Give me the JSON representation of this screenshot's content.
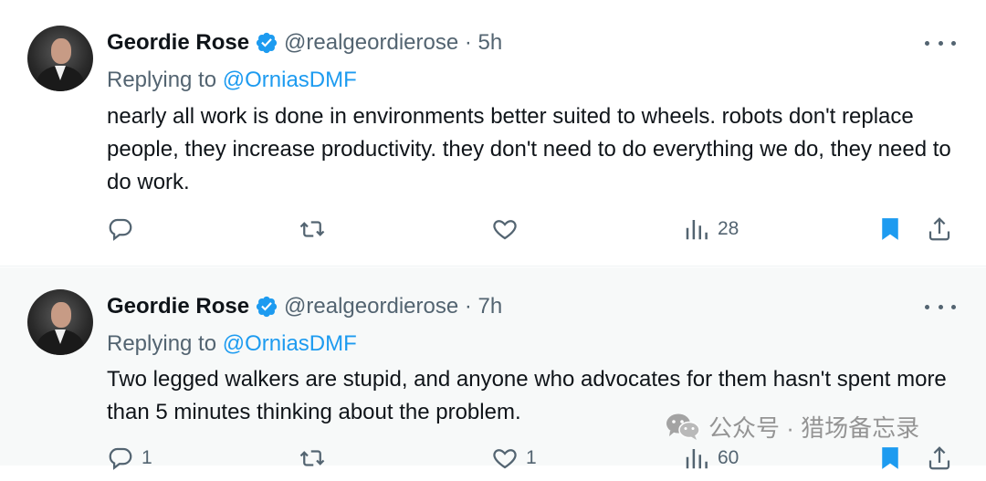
{
  "tweets": [
    {
      "name": "Geordie Rose",
      "handle": "@realgeordierose · 5h",
      "replying_prefix": "Replying to",
      "replying_to": "@OrniasDMF",
      "text": "nearly all work is done in environments better suited to wheels. robots don't replace people, they increase productivity. they don't need to do everything we do, they need to do work.",
      "views": "28",
      "bookmarked": true
    },
    {
      "name": "Geordie Rose",
      "handle": "@realgeordierose · 7h",
      "replying_prefix": "Replying to",
      "replying_to": "@OrniasDMF",
      "text": "Two legged walkers are stupid, and anyone who advocates for them hasn't spent more than 5 minutes thinking about the problem.",
      "replies": "1",
      "likes": "1",
      "views": "60",
      "bookmarked": true
    }
  ],
  "watermark": {
    "text": "公众号 · 猎场备忘录"
  },
  "colors": {
    "accent": "#1d9bf0",
    "muted": "#536471",
    "text": "#0f1419"
  },
  "icons": [
    "verified-badge-icon",
    "more-icon",
    "reply-icon",
    "retweet-icon",
    "like-icon",
    "views-icon",
    "bookmark-icon",
    "share-icon",
    "wechat-icon"
  ]
}
